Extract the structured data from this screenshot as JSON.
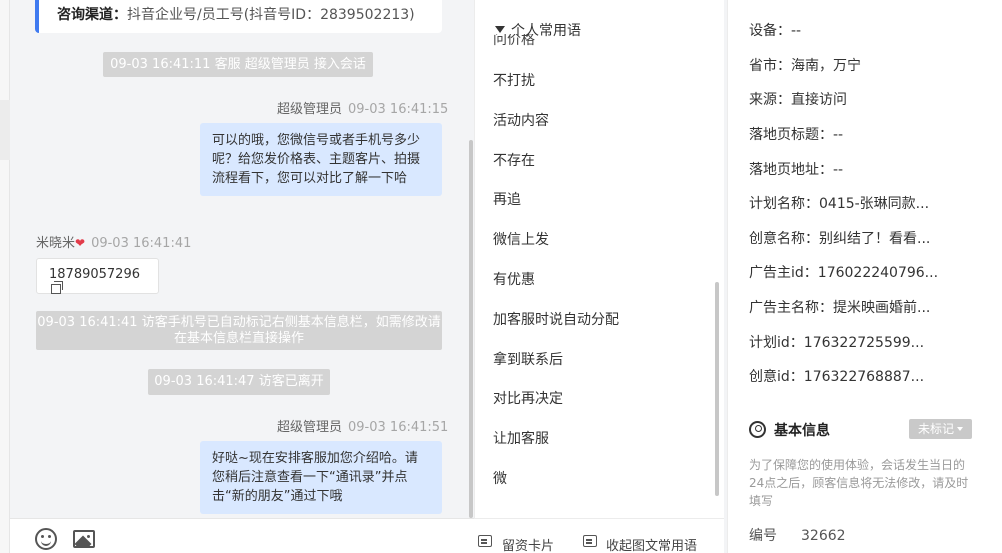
{
  "chat": {
    "channel_label": "咨询渠道：",
    "channel_value": "抖音企业号/员工号(抖音号ID：2839502213)",
    "sys1": "09-03 16:41:11 客服 超级管理员 接入会话",
    "msg1_sender": "超级管理员",
    "msg1_time": "09-03 16:41:15",
    "msg1_text": "可以的哦，您微信号或者手机号多少呢？给您发价格表、主题客片、拍摄流程看下，您可以对比了解一下哈",
    "visitor_name": "米晓米",
    "visitor_time": "09-03 16:41:41",
    "visitor_phone": "18789057296",
    "sys2": "09-03 16:41:41 访客手机号已自动标记右侧基本信息栏，如需修改请在基本信息栏直接操作",
    "sys3": "09-03 16:41:47 访客已离开",
    "msg2_sender": "超级管理员",
    "msg2_time": "09-03 16:41:51",
    "msg2_text": "好哒~现在安排客服加您介绍哈。请您稍后注意查看一下“通讯录”并点击“新的朋友”通过下哦"
  },
  "phrases": {
    "header": "个人常用语",
    "partial": "问价格",
    "items": [
      "不打扰",
      "活动内容",
      "不存在",
      "再追",
      "微信上发",
      "有优惠",
      "加客服时说自动分配",
      "拿到联系后",
      "对比再决定",
      "让加客服",
      "微"
    ],
    "toolbar_card": "留资卡片",
    "toolbar_collapse": "收起图文常用语"
  },
  "info": {
    "rows": [
      {
        "label": "设备：",
        "value": "--"
      },
      {
        "label": "省市：",
        "value": "海南，万宁"
      },
      {
        "label": "来源：",
        "value": "直接访问"
      },
      {
        "label": "落地页标题：",
        "value": "--"
      },
      {
        "label": "落地页地址：",
        "value": "--"
      },
      {
        "label": "计划名称：",
        "value": "0415-张琳同款..."
      },
      {
        "label": "创意名称：",
        "value": "别纠结了！看看..."
      },
      {
        "label": "广告主id：",
        "value": "176022240796..."
      },
      {
        "label": "广告主名称：",
        "value": "提米映画婚前..."
      },
      {
        "label": "计划id：",
        "value": "176322725599..."
      },
      {
        "label": "创意id：",
        "value": "176322768887..."
      }
    ],
    "section_title": "基本信息",
    "tag_label": "未标记",
    "notice": "为了保障您的使用体验，会话发生当日的24点之后，顾客信息将无法修改，请及时填写",
    "id_label": "编号",
    "id_value": "32662"
  }
}
